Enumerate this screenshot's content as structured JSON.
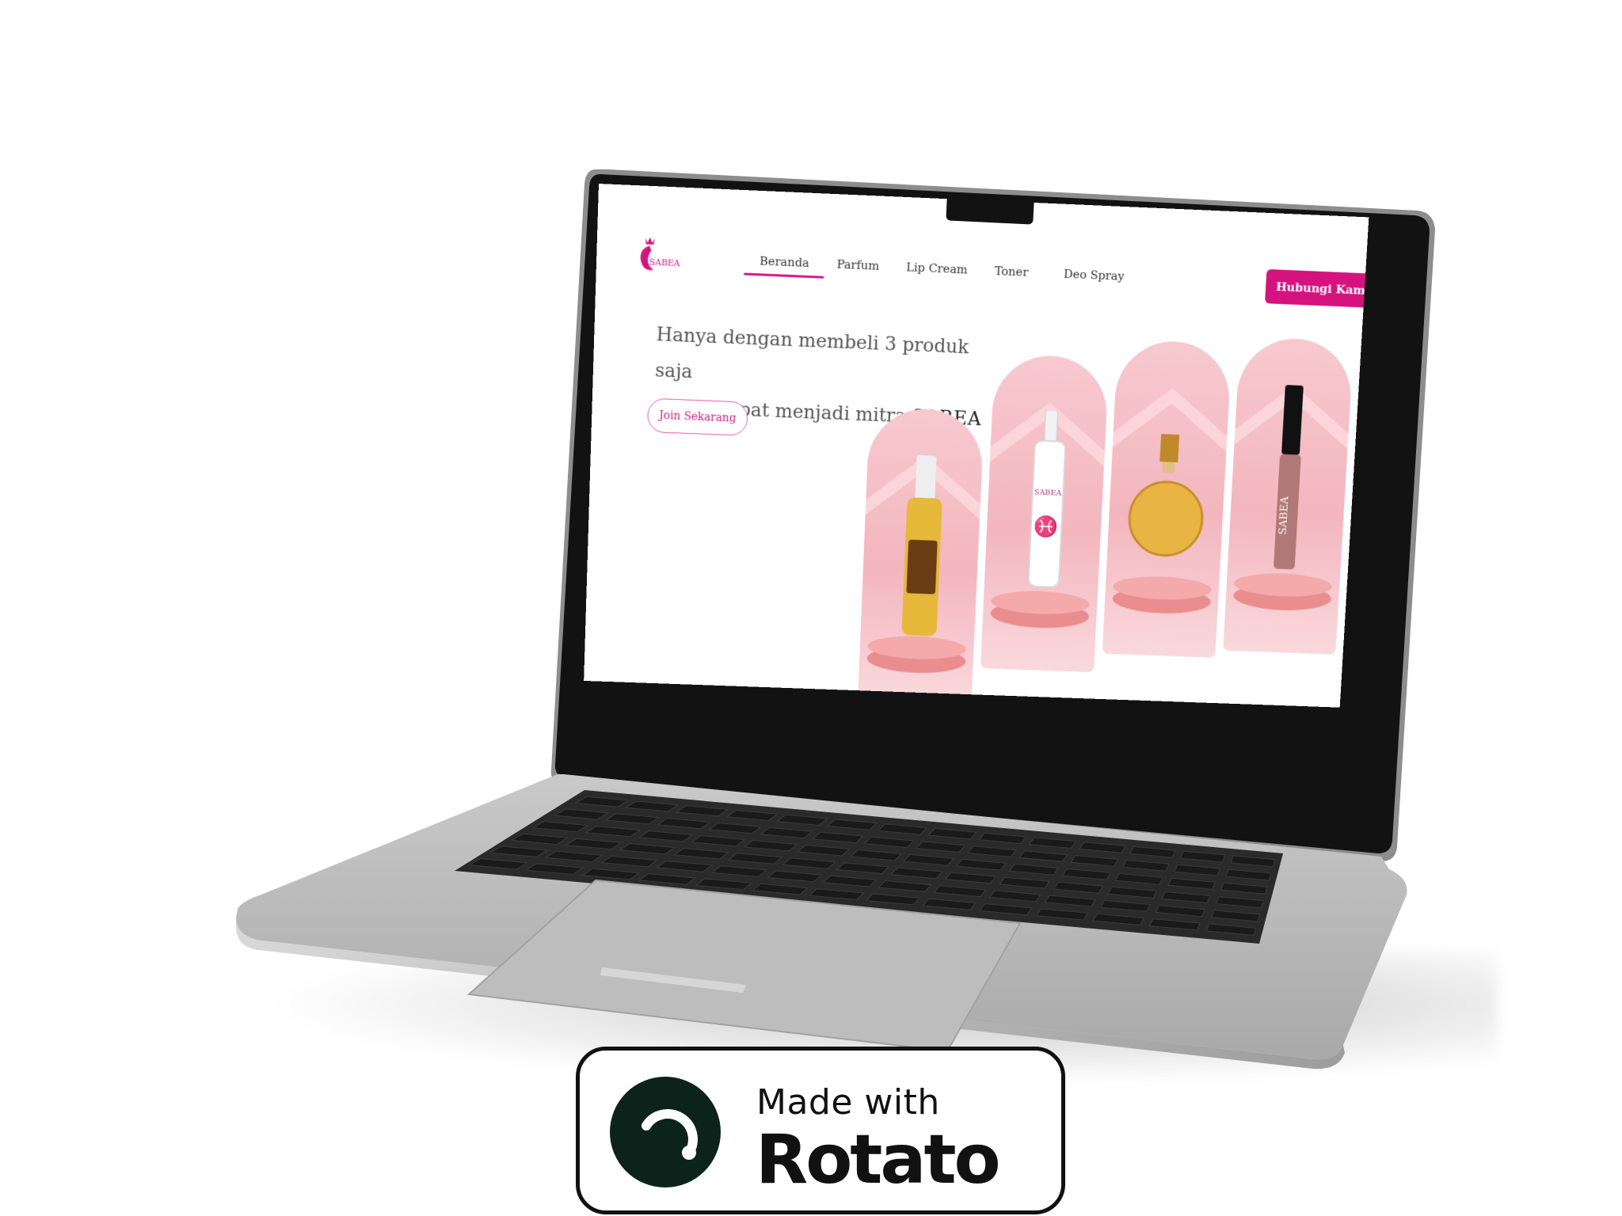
{
  "site": {
    "logo_text": "SABEA",
    "nav": [
      "Beranda",
      "Parfum",
      "Lip Cream",
      "Toner",
      "Deo Spray"
    ],
    "active_nav": "Beranda",
    "cta_label": "Hubungi Kami",
    "hero_line1": "Hanya dengan membeli 3 produk saja",
    "hero_line2_prefix": "sudah dapat menjadi mitra",
    "hero_brand": "SABEA",
    "join_label": "Join Sekarang",
    "products": [
      "hair-serum-bottle",
      "toner-spray-bottle",
      "perfume-bottle",
      "lip-cream-tube"
    ],
    "lip_label": "SABEA"
  },
  "badge": {
    "line1": "Made with",
    "line2": "Rotato"
  },
  "colors": {
    "brand_pink": "#d5137f",
    "card_pink": "#f3b6be",
    "pedestal": "#ea8d8f",
    "laptop_silver": "#b9b9b9",
    "keyboard": "#232323"
  }
}
